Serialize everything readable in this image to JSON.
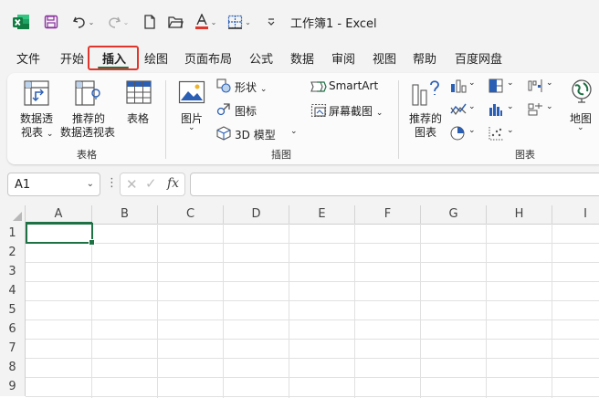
{
  "window": {
    "title": "工作簿1  -  Excel"
  },
  "tabs": [
    "文件",
    "开始",
    "插入",
    "绘图",
    "页面布局",
    "公式",
    "数据",
    "审阅",
    "视图",
    "帮助",
    "百度网盘"
  ],
  "active_tab": "插入",
  "ribbon": {
    "tables_group": {
      "label": "表格",
      "pivot_line1": "数据透",
      "pivot_line2": "视表",
      "rec_pivot_line1": "推荐的",
      "rec_pivot_line2": "数据透视表",
      "table": "表格"
    },
    "illustrations_group": {
      "label": "插图",
      "pictures": "图片",
      "shapes": "形状",
      "icons": "图标",
      "model3d": "3D 模型",
      "smartart": "SmartArt",
      "screenshot": "屏幕截图"
    },
    "charts_group": {
      "label": "图表",
      "rec_charts_line1": "推荐的",
      "rec_charts_line2": "图表",
      "maps": "地图"
    }
  },
  "formula_bar": {
    "name_box": "A1",
    "fx": "fx",
    "value": ""
  },
  "grid": {
    "columns": [
      "A",
      "B",
      "C",
      "D",
      "E",
      "F",
      "G",
      "H",
      "I"
    ],
    "rows": [
      "1",
      "2",
      "3",
      "4",
      "5",
      "6",
      "7",
      "8",
      "9"
    ],
    "selected_cell": "A1"
  },
  "colors": {
    "accent": "#217346",
    "highlight": "#e0352b"
  }
}
